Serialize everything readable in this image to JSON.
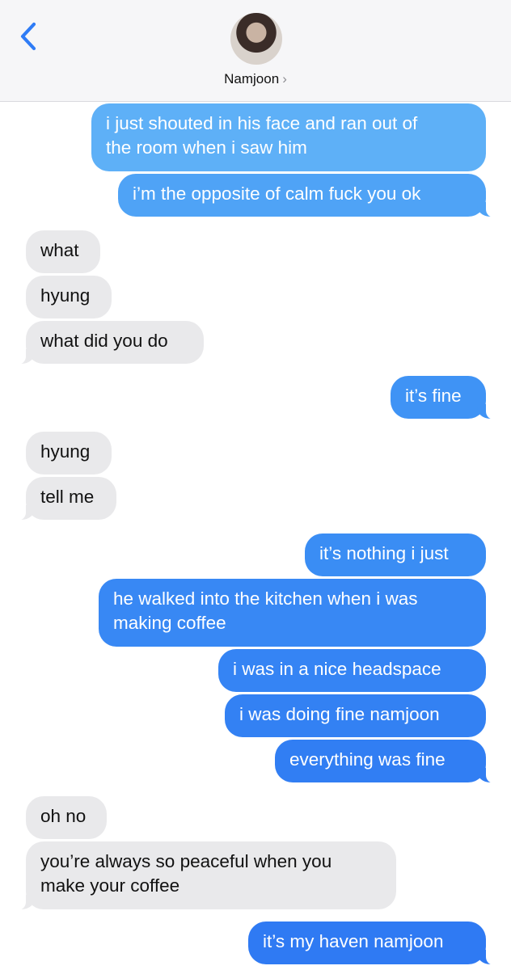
{
  "header": {
    "back_icon": "chevron-left-icon",
    "contact_name": "Namjoon",
    "contact_chevron": "›",
    "accent": "#2f7cf6"
  },
  "messages": [
    {
      "side": "sent",
      "text": "i just shouted in his face and ran out of\nthe room when i saw him",
      "color": "#5eb0f7"
    },
    {
      "side": "sent",
      "text": "i’m the opposite of calm fuck you ok",
      "color": "#4fa3f6"
    },
    {
      "side": "recv",
      "text": "what"
    },
    {
      "side": "recv",
      "text": "hyung"
    },
    {
      "side": "recv",
      "text": "what did you do"
    },
    {
      "side": "sent",
      "text": "it’s fine",
      "color": "#3f93f5"
    },
    {
      "side": "recv",
      "text": "hyung"
    },
    {
      "side": "recv",
      "text": "tell me"
    },
    {
      "side": "sent",
      "text": "it’s nothing i just",
      "color": "#3a8df4"
    },
    {
      "side": "sent",
      "text": "he walked into the kitchen when i was\nmaking coffee",
      "color": "#3888f4"
    },
    {
      "side": "sent",
      "text": "i was in a nice headspace",
      "color": "#3584f4"
    },
    {
      "side": "sent",
      "text": "i was doing fine namjoon",
      "color": "#3381f3"
    },
    {
      "side": "sent",
      "text": "everything was fine",
      "color": "#317ef3"
    },
    {
      "side": "recv",
      "text": "oh no"
    },
    {
      "side": "recv",
      "text": "you’re always so peaceful when you\nmake your coffee"
    },
    {
      "side": "sent",
      "text": "it’s my haven namjoon",
      "color": "#2f7af3"
    }
  ]
}
